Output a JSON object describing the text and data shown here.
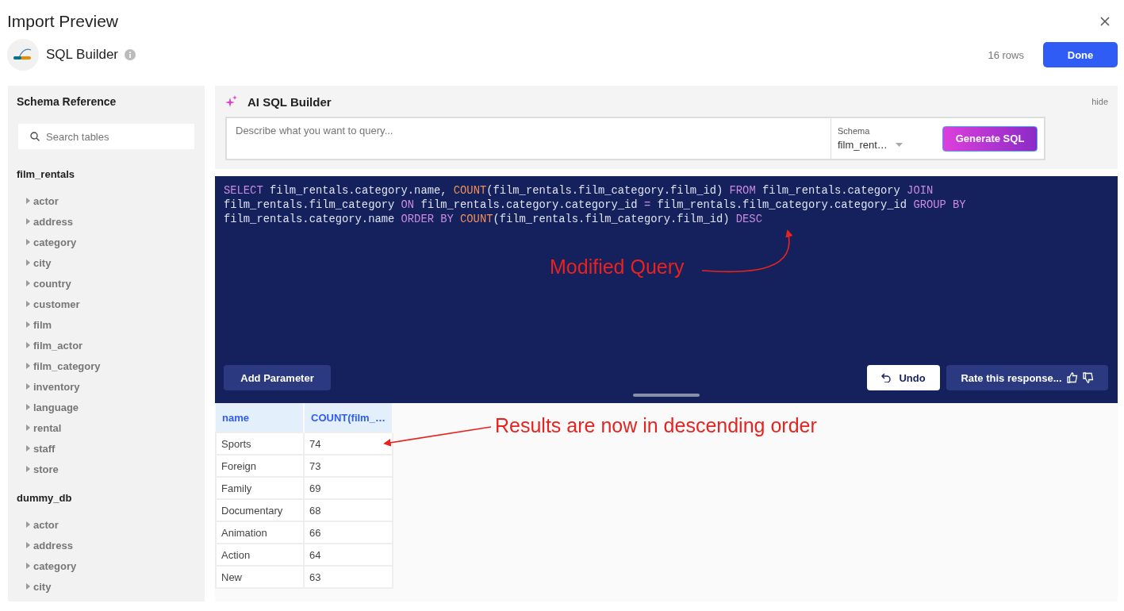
{
  "window": {
    "title": "Import Preview"
  },
  "source": {
    "name": "SQL Builder",
    "row_count": "16 rows",
    "done_button": "Done"
  },
  "sidebar": {
    "title": "Schema Reference",
    "search": {
      "placeholder": "Search tables"
    },
    "schemas": [
      {
        "name": "film_rentals",
        "tables": [
          "actor",
          "address",
          "category",
          "city",
          "country",
          "customer",
          "film",
          "film_actor",
          "film_category",
          "inventory",
          "language",
          "rental",
          "staff",
          "store"
        ]
      },
      {
        "name": "dummy_db",
        "tables": [
          "actor",
          "address",
          "category",
          "city"
        ]
      }
    ]
  },
  "ai_builder": {
    "title": "AI SQL Builder",
    "hide_link": "hide",
    "prompt": {
      "placeholder": "Describe what you want to query..."
    },
    "schema_label": "Schema",
    "schema_value": "film_rent…",
    "generate_button": "Generate SQL"
  },
  "editor": {
    "sql": [
      {
        "kind": "keyword",
        "text": "SELECT"
      },
      {
        "kind": "plain",
        "text": " film_rentals.category.name, "
      },
      {
        "kind": "function",
        "text": "COUNT"
      },
      {
        "kind": "plain",
        "text": "(film_rentals.film_category.film_id) "
      },
      {
        "kind": "keyword",
        "text": "FROM"
      },
      {
        "kind": "plain",
        "text": " film_rentals.category "
      },
      {
        "kind": "keyword",
        "text": "JOIN"
      },
      {
        "kind": "plain",
        "text": " film_rentals.film_category "
      },
      {
        "kind": "keyword",
        "text": "ON"
      },
      {
        "kind": "plain",
        "text": " film_rentals.category.category_id "
      },
      {
        "kind": "keyword",
        "text": "="
      },
      {
        "kind": "plain",
        "text": " film_rentals.film_category.category_id "
      },
      {
        "kind": "keyword",
        "text": "GROUP BY"
      },
      {
        "kind": "plain",
        "text": " film_rentals.category.name "
      },
      {
        "kind": "keyword",
        "text": "ORDER BY "
      },
      {
        "kind": "function",
        "text": "COUNT"
      },
      {
        "kind": "plain",
        "text": "(film_rentals.film_category.film_id) "
      },
      {
        "kind": "keyword",
        "text": "DESC"
      }
    ],
    "add_parameter_button": "Add Parameter",
    "undo_button": "Undo",
    "rate_button": "Rate this response..."
  },
  "results": {
    "columns": [
      "name",
      "COUNT(film_…"
    ],
    "rows": [
      [
        "Sports",
        "74"
      ],
      [
        "Foreign",
        "73"
      ],
      [
        "Family",
        "69"
      ],
      [
        "Documentary",
        "68"
      ],
      [
        "Animation",
        "66"
      ],
      [
        "Action",
        "64"
      ],
      [
        "New",
        "63"
      ]
    ]
  },
  "annotations": [
    "Modified Query",
    "Results are now in descending order"
  ]
}
